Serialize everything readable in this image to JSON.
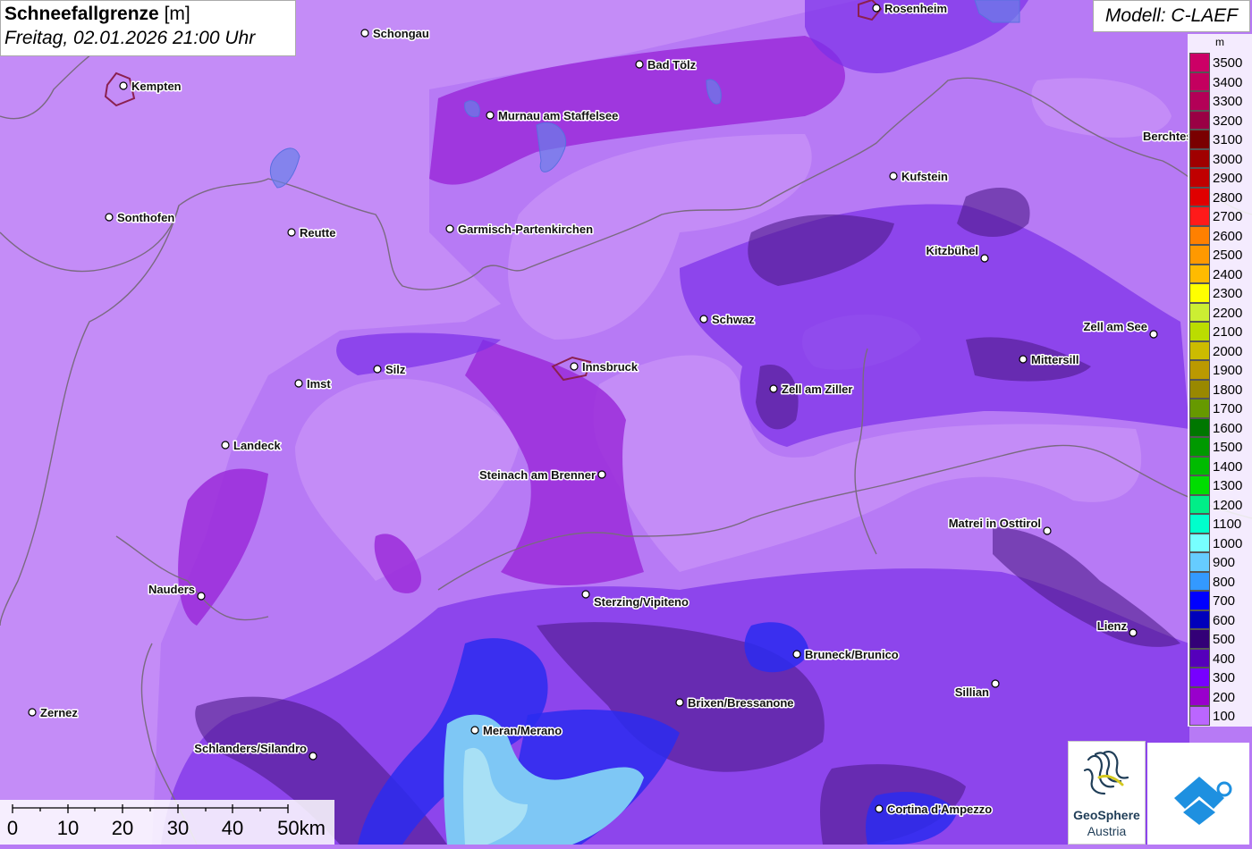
{
  "header": {
    "title": "Schneefallgrenze",
    "unit": "[m]",
    "datetime": "Freitag, 02.01.2026 21:00 Uhr",
    "model": "Modell: C-LAEF"
  },
  "legend": {
    "unit": "m",
    "levels": [
      {
        "value": "3500",
        "color": "#cc0066"
      },
      {
        "value": "3400",
        "color": "#c4005f"
      },
      {
        "value": "3300",
        "color": "#b30057"
      },
      {
        "value": "3200",
        "color": "#990044"
      },
      {
        "value": "3100",
        "color": "#7a0000"
      },
      {
        "value": "3000",
        "color": "#a00000"
      },
      {
        "value": "2900",
        "color": "#c00000"
      },
      {
        "value": "2800",
        "color": "#e00000"
      },
      {
        "value": "2700",
        "color": "#ff1a1a"
      },
      {
        "value": "2600",
        "color": "#ff8000"
      },
      {
        "value": "2500",
        "color": "#ff9900"
      },
      {
        "value": "2400",
        "color": "#ffbb00"
      },
      {
        "value": "2300",
        "color": "#ffff00"
      },
      {
        "value": "2200",
        "color": "#ccee33"
      },
      {
        "value": "2100",
        "color": "#bbdd00"
      },
      {
        "value": "2000",
        "color": "#ccbb00"
      },
      {
        "value": "1900",
        "color": "#bb9900"
      },
      {
        "value": "1800",
        "color": "#998800"
      },
      {
        "value": "1700",
        "color": "#669900"
      },
      {
        "value": "1600",
        "color": "#007700"
      },
      {
        "value": "1500",
        "color": "#009900"
      },
      {
        "value": "1400",
        "color": "#00bb00"
      },
      {
        "value": "1300",
        "color": "#00dd00"
      },
      {
        "value": "1200",
        "color": "#00ee88"
      },
      {
        "value": "1100",
        "color": "#00ffcc"
      },
      {
        "value": "1000",
        "color": "#77ffff"
      },
      {
        "value": "900",
        "color": "#66ccff"
      },
      {
        "value": "800",
        "color": "#3399ff"
      },
      {
        "value": "700",
        "color": "#0000ff"
      },
      {
        "value": "600",
        "color": "#0000bb"
      },
      {
        "value": "500",
        "color": "#330077"
      },
      {
        "value": "400",
        "color": "#5500bb"
      },
      {
        "value": "300",
        "color": "#7700ff"
      },
      {
        "value": "200",
        "color": "#9900cc"
      },
      {
        "value": "100",
        "color": "#bb66ff"
      }
    ]
  },
  "scale_bar": {
    "labels": [
      "0",
      "10",
      "20",
      "30",
      "40",
      "50km"
    ]
  },
  "cities": [
    {
      "name": "Rosenheim"
    },
    {
      "name": "Schongau"
    },
    {
      "name": "Bad Tölz"
    },
    {
      "name": "Kempten"
    },
    {
      "name": "Murnau am Staffelsee"
    },
    {
      "name": "Berchtes"
    },
    {
      "name": "Kufstein"
    },
    {
      "name": "Sonthofen"
    },
    {
      "name": "Reutte"
    },
    {
      "name": "Garmisch-Partenkirchen"
    },
    {
      "name": "Kitzbühel"
    },
    {
      "name": "Schwaz"
    },
    {
      "name": "Zell am See"
    },
    {
      "name": "Mittersill"
    },
    {
      "name": "Imst"
    },
    {
      "name": "Silz"
    },
    {
      "name": "Innsbruck"
    },
    {
      "name": "Zell am Ziller"
    },
    {
      "name": "Landeck"
    },
    {
      "name": "Steinach am Brenner"
    },
    {
      "name": "Matrei in Osttirol"
    },
    {
      "name": "Nauders"
    },
    {
      "name": "Sterzing/Vipiteno"
    },
    {
      "name": "Lienz"
    },
    {
      "name": "Bruneck/Brunico"
    },
    {
      "name": "Sillian"
    },
    {
      "name": "Brixen/Bressanone"
    },
    {
      "name": "Zernez"
    },
    {
      "name": "Meran/Merano"
    },
    {
      "name": "Schlanders/Silandro"
    },
    {
      "name": "Cortina d'Ampezzo"
    }
  ],
  "logos": {
    "geosphere_name": "GeoSphere",
    "geosphere_sub": "Austria"
  },
  "colors": {
    "base": "#b77af5",
    "light": "#c48cf7",
    "magenta": "#9b2bd9",
    "violet": "#7a2fe8",
    "dark": "#4e1a8a",
    "blue": "#2c2cf0",
    "lightblue": "#7ec7f5",
    "cyan": "#a8e0f5",
    "border": "#7a6a80",
    "brand": "#1e90e0"
  }
}
